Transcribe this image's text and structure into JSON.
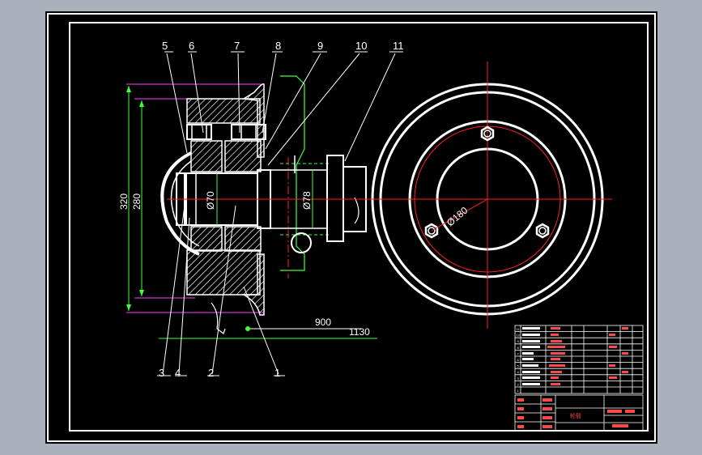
{
  "part_numbers_top": [
    "5",
    "6",
    "7",
    "8",
    "9",
    "10",
    "11"
  ],
  "part_numbers_bottom": [
    "3",
    "4",
    "2",
    "1"
  ],
  "dimensions": {
    "d320": "320",
    "d280": "280",
    "d70": "Ø70",
    "d78": "Ø78",
    "d180": "Ø180",
    "d900": "900",
    "d1130": "1130"
  },
  "title_block": {
    "title": "轮毂",
    "rows": [
      "11",
      "10",
      "9",
      "8",
      "7",
      "6",
      "5",
      "4",
      "3",
      "2",
      "1"
    ]
  },
  "colors": {
    "sheet": "#000000",
    "frame": "#ffffff",
    "centerline": "#ff2020",
    "dimension": "#40ff40",
    "leader": "#ffffff",
    "hatch": "#ffffff",
    "hidden": "#40ff40",
    "magenta": "#ff40ff"
  }
}
